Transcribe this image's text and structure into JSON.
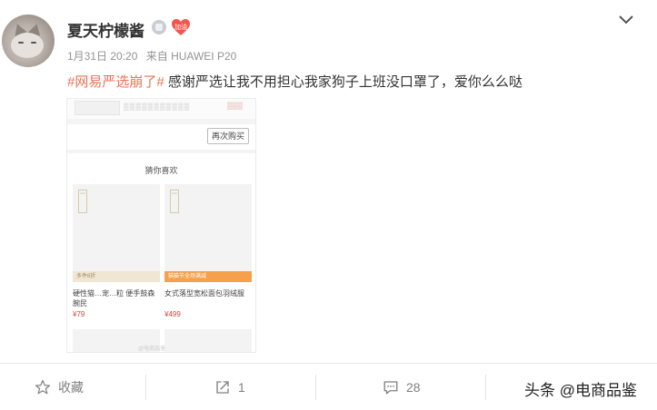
{
  "post": {
    "username": "夏天柠檬酱",
    "badge_text": "加油",
    "date": "1月31日 20:20",
    "source": "来自 HUAWEI P20",
    "hashtag": "#网易严选崩了#",
    "text": "感谢严选让我不用担心我家狗子上班没口罩了，爱你么么哒"
  },
  "screenshot": {
    "rebuy_button": "再次购买",
    "section_title": "猜你喜欢",
    "products": [
      {
        "bar": "多件8折",
        "name": "硬性猫…宠…粒 便手鼓森腕民",
        "price": "¥79"
      },
      {
        "bar": "猫猫节全场满减",
        "name": "女式落型宽松面包羽绒服",
        "price": "¥499"
      }
    ],
    "watermark": "@电商品鉴"
  },
  "actions": {
    "favorite_label": "收藏",
    "repost_count": "1",
    "comment_count": "28"
  },
  "image_watermark": "头条 @电商品鉴",
  "colors": {
    "accent": "#eb7350",
    "badge_red": "#f2574b"
  }
}
